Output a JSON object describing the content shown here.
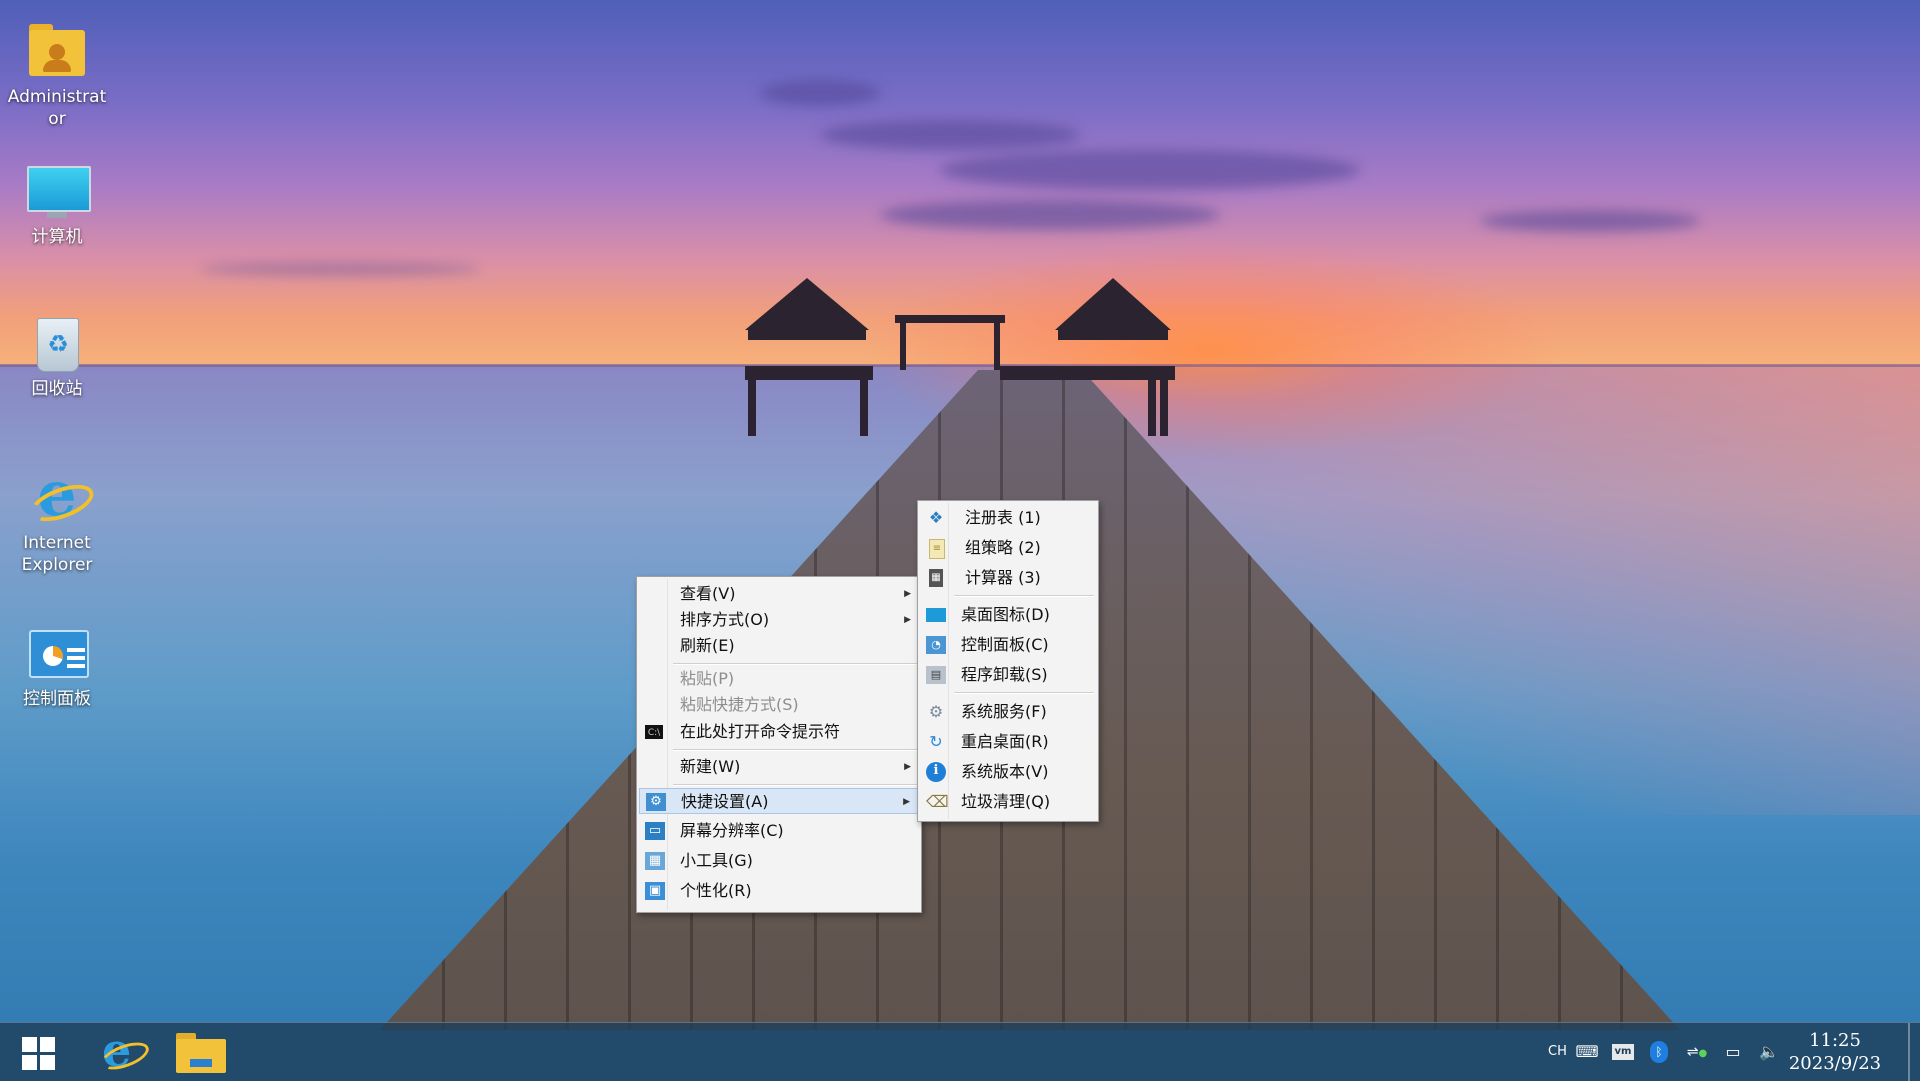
{
  "desktop": {
    "icons": [
      {
        "label": "Administrator",
        "icon": "user-folder-icon"
      },
      {
        "label": "计算机",
        "icon": "computer-monitor-icon"
      },
      {
        "label": "回收站",
        "icon": "recycle-bin-icon"
      },
      {
        "label": "Internet Explorer",
        "icon": "internet-explorer-icon"
      },
      {
        "label": "控制面板",
        "icon": "control-panel-icon"
      }
    ]
  },
  "context_menu": {
    "items": [
      {
        "label": "查看(V)",
        "has_submenu": true
      },
      {
        "label": "排序方式(O)",
        "has_submenu": true
      },
      {
        "label": "刷新(E)"
      },
      {
        "label": "粘贴(P)",
        "disabled": true
      },
      {
        "label": "粘贴快捷方式(S)",
        "disabled": true
      },
      {
        "label": "在此处打开命令提示符",
        "icon": "command-prompt-icon"
      },
      {
        "label": "新建(W)",
        "has_submenu": true
      },
      {
        "label": "快捷设置(A)",
        "icon": "quick-settings-icon",
        "has_submenu": true,
        "active": true
      },
      {
        "label": "屏幕分辨率(C)",
        "icon": "screen-resolution-icon"
      },
      {
        "label": "小工具(G)",
        "icon": "gadgets-icon"
      },
      {
        "label": "个性化(R)",
        "icon": "personalize-icon"
      }
    ]
  },
  "submenu": {
    "items": [
      {
        "label": "注册表  (1)",
        "icon": "registry-icon"
      },
      {
        "label": "组策略  (2)",
        "icon": "group-policy-icon"
      },
      {
        "label": "计算器  (3)",
        "icon": "calculator-icon"
      },
      {
        "label": "桌面图标(D)",
        "icon": "desktop-icons-icon"
      },
      {
        "label": "控制面板(C)",
        "icon": "control-panel-icon"
      },
      {
        "label": "程序卸载(S)",
        "icon": "uninstall-icon"
      },
      {
        "label": "系统服务(F)",
        "icon": "services-gear-icon"
      },
      {
        "label": "重启桌面(R)",
        "icon": "refresh-icon"
      },
      {
        "label": "系统版本(V)",
        "icon": "info-icon"
      },
      {
        "label": "垃圾清理(Q)",
        "icon": "cleanup-icon"
      }
    ]
  },
  "taskbar": {
    "pinned": [
      "start-button",
      "internet-explorer",
      "file-explorer"
    ],
    "tray": {
      "language": "CH",
      "icons": [
        "keyboard-icon",
        "vm-icon",
        "bluetooth-icon",
        "network-check-icon",
        "monitor-icon",
        "volume-icon"
      ]
    },
    "clock": {
      "time": "11:25",
      "date": "2023/9/23"
    }
  },
  "colors": {
    "menu_background": "#f3f3f3",
    "menu_active": "#d8e6f6",
    "taskbar": "#1e405c",
    "disabled_text": "#8e8e8e"
  }
}
